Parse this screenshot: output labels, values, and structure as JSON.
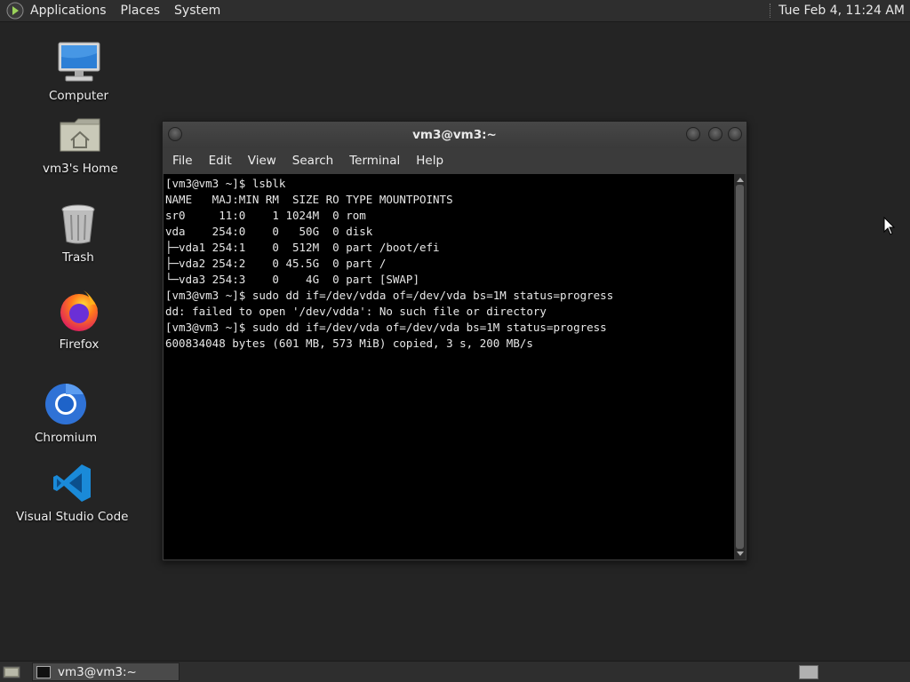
{
  "top_panel": {
    "menus": [
      "Applications",
      "Places",
      "System"
    ],
    "clock": "Tue Feb  4, 11:24 AM"
  },
  "desktop_icons": [
    {
      "label": "Computer",
      "icon": "computer-icon"
    },
    {
      "label": "vm3's Home",
      "icon": "home-folder-icon"
    },
    {
      "label": "Trash",
      "icon": "trash-icon"
    },
    {
      "label": "Firefox",
      "icon": "firefox-icon"
    },
    {
      "label": "Chromium",
      "icon": "chromium-icon"
    },
    {
      "label": "Visual Studio Code",
      "icon": "vscode-icon"
    }
  ],
  "terminal": {
    "title": "vm3@vm3:~",
    "menus": [
      "File",
      "Edit",
      "View",
      "Search",
      "Terminal",
      "Help"
    ],
    "output": "[vm3@vm3 ~]$ lsblk\nNAME   MAJ:MIN RM  SIZE RO TYPE MOUNTPOINTS\nsr0     11:0    1 1024M  0 rom\nvda    254:0    0   50G  0 disk\n├─vda1 254:1    0  512M  0 part /boot/efi\n├─vda2 254:2    0 45.5G  0 part /\n└─vda3 254:3    0    4G  0 part [SWAP]\n[vm3@vm3 ~]$ sudo dd if=/dev/vdda of=/dev/vda bs=1M status=progress\ndd: failed to open '/dev/vdda': No such file or directory\n[vm3@vm3 ~]$ sudo dd if=/dev/vda of=/dev/vda bs=1M status=progress\n600834048 bytes (601 MB, 573 MiB) copied, 3 s, 200 MB/s"
  },
  "taskbar": {
    "items": [
      "vm3@vm3:~"
    ]
  },
  "colors": {
    "desktop_bg": "#242424",
    "panel_bg": "#2e2e2e",
    "terminal_bg": "#000000",
    "terminal_fg": "#e8e8e8"
  }
}
